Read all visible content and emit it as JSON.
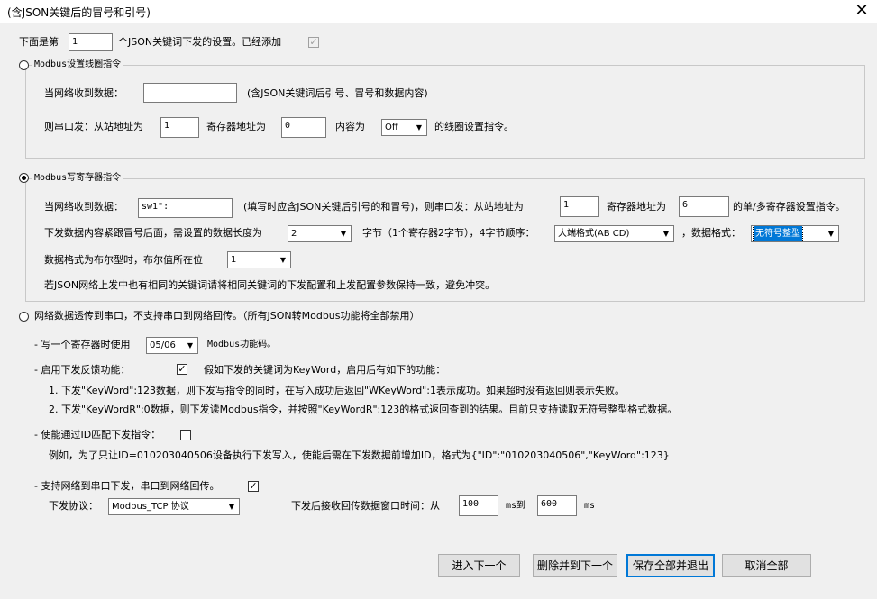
{
  "window": {
    "title": "(含JSON关键后的冒号和引号)"
  },
  "intro": {
    "prefix": "下面是第",
    "index_value": "1",
    "suffix": "个JSON关键词下发的设置。已经添加"
  },
  "coil": {
    "title": "Modbus设置线圈指令",
    "recv_label": "当网络收到数据：",
    "recv_value": "",
    "recv_hint": "(含JSON关键词后引号、冒号和数据内容)",
    "send_label": "则串口发：从站地址为",
    "slave_value": "1",
    "reg_label": "寄存器地址为",
    "reg_value": "0",
    "content_label": "内容为",
    "content_value": "Off",
    "end_label": "的线圈设置指令。"
  },
  "reg": {
    "title": "Modbus写寄存器指令",
    "recv_label": "当网络收到数据：",
    "recv_value": "sw1\":",
    "hint1": "(填写时应含JSON关键后引号的和冒号)，则串口发：从站地址为",
    "slave_value": "1",
    "reg_label": "寄存器地址为",
    "reg_value": "6",
    "end_label": "的单/多寄存器设置指令。",
    "len_label": "下发数据内容紧跟冒号后面，需设置的数据长度为",
    "len_value": "2",
    "byte_label": "字节（1个寄存器2字节），4字节顺序：",
    "order_value": "大端格式(AB CD)",
    "format_label": "，数据格式：",
    "format_value": "无符号整型",
    "bool_label": "数据格式为布尔型时，布尔值所在位",
    "bool_value": "1",
    "note": "若JSON网络上发中也有相同的关键词请将相同关键词的下发配置和上发配置参数保持一致，避免冲突。"
  },
  "passthrough": {
    "title": "网络数据透传到串口，不支持串口到网络回传。（所有JSON转Modbus功能将全部禁用）",
    "func_prefix": "- 写一个寄存器时使用",
    "func_value": "05/06",
    "func_suffix": "Modbus功能码。",
    "feedback_label": "- 启用下发反馈功能：",
    "feedback_desc": "假如下发的关键词为KeyWord，启用后有如下的功能：",
    "line1": "1. 下发\"KeyWord\":123数据，则下发写指令的同时，在写入成功后返回\"WKeyWord\":1表示成功。如果超时没有返回则表示失败。",
    "line2": "2. 下发\"KeyWordR\":0数据，则下发读Modbus指令，并按照\"KeyWordR\":123的格式返回查到的结果。目前只支持读取无符号整型格式数据。",
    "id_label": "- 使能通过ID匹配下发指令：",
    "id_example": "例如，为了只让ID=010203040506设备执行下发写入，使能后需在下发数据前增加ID，格式为{\"ID\":\"010203040506\",\"KeyWord\":123}",
    "net_label": "- 支持网络到串口下发，串口到网络回传。",
    "proto_label": "下发协议：",
    "proto_value": "Modbus_TCP 协议",
    "window_label": "下发后接收回传数据窗口时间：从",
    "from_value": "100",
    "ms_to": "ms到",
    "to_value": "600",
    "ms": "ms"
  },
  "buttons": {
    "next": "进入下一个",
    "delete_next": "删除并到下一个",
    "save_exit": "保存全部并退出",
    "cancel": "取消全部"
  },
  "icons": {
    "check": "✓",
    "dropdown": "▼",
    "close": "✕"
  }
}
